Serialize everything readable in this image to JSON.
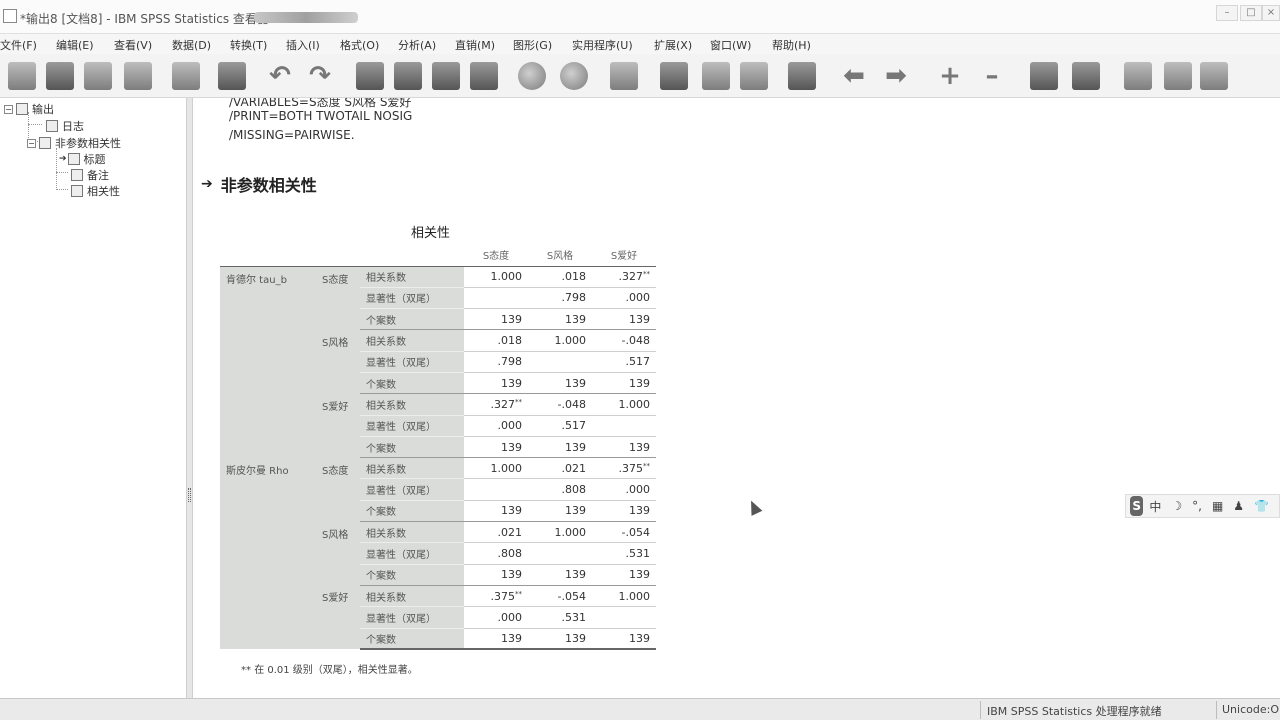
{
  "window": {
    "title": "*输出8 [文档8] - IBM SPSS Statistics 查看器",
    "controls": [
      "–",
      "□",
      "×"
    ]
  },
  "menu": [
    "文件(F)",
    "编辑(E)",
    "查看(V)",
    "数据(D)",
    "转换(T)",
    "插入(I)",
    "格式(O)",
    "分析(A)",
    "直销(M)",
    "图形(G)",
    "实用程序(U)",
    "扩展(X)",
    "窗口(W)",
    "帮助(H)"
  ],
  "toolbar_icons": [
    "open-icon",
    "save-icon",
    "print-icon",
    "print-preview-icon",
    "export-icon",
    "recall-dialog-icon",
    "undo-icon",
    "redo-icon",
    "goto-data-icon",
    "goto-case-icon",
    "goto-variable-icon",
    "variables-icon",
    "chart-icon",
    "circle-icon",
    "select-cases-icon",
    "value-labels-icon",
    "designate-window-icon",
    "run-script-icon",
    "stop-icon",
    "back-icon",
    "forward-icon",
    "expand-icon",
    "collapse-icon",
    "show-icon",
    "hide-icon",
    "insert-heading-icon",
    "insert-title-icon",
    "insert-text-icon"
  ],
  "outline": {
    "root": "输出",
    "log": "日志",
    "section": "非参数相关性",
    "children": [
      "标题",
      "备注",
      "相关性"
    ]
  },
  "syntax_lines": [
    "/VARIABLES=S态度 S风格 S爱好",
    "/PRINT=BOTH TWOTAIL NOSIG",
    "/MISSING=PAIRWISE."
  ],
  "heading": "非参数相关性",
  "table": {
    "title": "相关性",
    "columns": [
      "S态度",
      "S风格",
      "S爱好"
    ],
    "methods": [
      {
        "name": "肯德尔 tau_b",
        "vars": [
          {
            "name": "S态度",
            "rows": [
              {
                "stat": "相关系数",
                "values": [
                  "1.000",
                  ".018",
                  ".327"
                ],
                "stars": [
                  "",
                  "",
                  "**"
                ]
              },
              {
                "stat": "显著性（双尾）",
                "values": [
                  "",
                  ".798",
                  ".000"
                ],
                "stars": [
                  "",
                  "",
                  ""
                ]
              },
              {
                "stat": "个案数",
                "values": [
                  "139",
                  "139",
                  "139"
                ],
                "stars": [
                  "",
                  "",
                  ""
                ]
              }
            ]
          },
          {
            "name": "S风格",
            "rows": [
              {
                "stat": "相关系数",
                "values": [
                  ".018",
                  "1.000",
                  "-.048"
                ],
                "stars": [
                  "",
                  "",
                  ""
                ]
              },
              {
                "stat": "显著性（双尾）",
                "values": [
                  ".798",
                  "",
                  ".517"
                ],
                "stars": [
                  "",
                  "",
                  ""
                ]
              },
              {
                "stat": "个案数",
                "values": [
                  "139",
                  "139",
                  "139"
                ],
                "stars": [
                  "",
                  "",
                  ""
                ]
              }
            ]
          },
          {
            "name": "S爱好",
            "rows": [
              {
                "stat": "相关系数",
                "values": [
                  ".327",
                  "-.048",
                  "1.000"
                ],
                "stars": [
                  "**",
                  "",
                  ""
                ]
              },
              {
                "stat": "显著性（双尾）",
                "values": [
                  ".000",
                  ".517",
                  ""
                ],
                "stars": [
                  "",
                  "",
                  ""
                ]
              },
              {
                "stat": "个案数",
                "values": [
                  "139",
                  "139",
                  "139"
                ],
                "stars": [
                  "",
                  "",
                  ""
                ]
              }
            ]
          }
        ]
      },
      {
        "name": "斯皮尔曼 Rho",
        "vars": [
          {
            "name": "S态度",
            "rows": [
              {
                "stat": "相关系数",
                "values": [
                  "1.000",
                  ".021",
                  ".375"
                ],
                "stars": [
                  "",
                  "",
                  "**"
                ]
              },
              {
                "stat": "显著性（双尾）",
                "values": [
                  "",
                  ".808",
                  ".000"
                ],
                "stars": [
                  "",
                  "",
                  ""
                ]
              },
              {
                "stat": "个案数",
                "values": [
                  "139",
                  "139",
                  "139"
                ],
                "stars": [
                  "",
                  "",
                  ""
                ]
              }
            ]
          },
          {
            "name": "S风格",
            "rows": [
              {
                "stat": "相关系数",
                "values": [
                  ".021",
                  "1.000",
                  "-.054"
                ],
                "stars": [
                  "",
                  "",
                  ""
                ]
              },
              {
                "stat": "显著性（双尾）",
                "values": [
                  ".808",
                  "",
                  ".531"
                ],
                "stars": [
                  "",
                  "",
                  ""
                ]
              },
              {
                "stat": "个案数",
                "values": [
                  "139",
                  "139",
                  "139"
                ],
                "stars": [
                  "",
                  "",
                  ""
                ]
              }
            ]
          },
          {
            "name": "S爱好",
            "rows": [
              {
                "stat": "相关系数",
                "values": [
                  ".375",
                  "-.054",
                  "1.000"
                ],
                "stars": [
                  "**",
                  "",
                  ""
                ]
              },
              {
                "stat": "显著性（双尾）",
                "values": [
                  ".000",
                  ".531",
                  ""
                ],
                "stars": [
                  "",
                  "",
                  ""
                ]
              },
              {
                "stat": "个案数",
                "values": [
                  "139",
                  "139",
                  "139"
                ],
                "stars": [
                  "",
                  "",
                  ""
                ]
              }
            ]
          }
        ]
      }
    ],
    "footnote_mark": "**",
    "footnote": "在 0.01 级别（双尾），相关性显著。"
  },
  "ime": {
    "logo": "S",
    "items": [
      "中",
      "☽",
      "°,",
      "▦",
      "♟",
      "👕"
    ]
  },
  "status": {
    "processor": "IBM SPSS Statistics 处理程序就绪",
    "unicode": "Unicode:ON"
  }
}
